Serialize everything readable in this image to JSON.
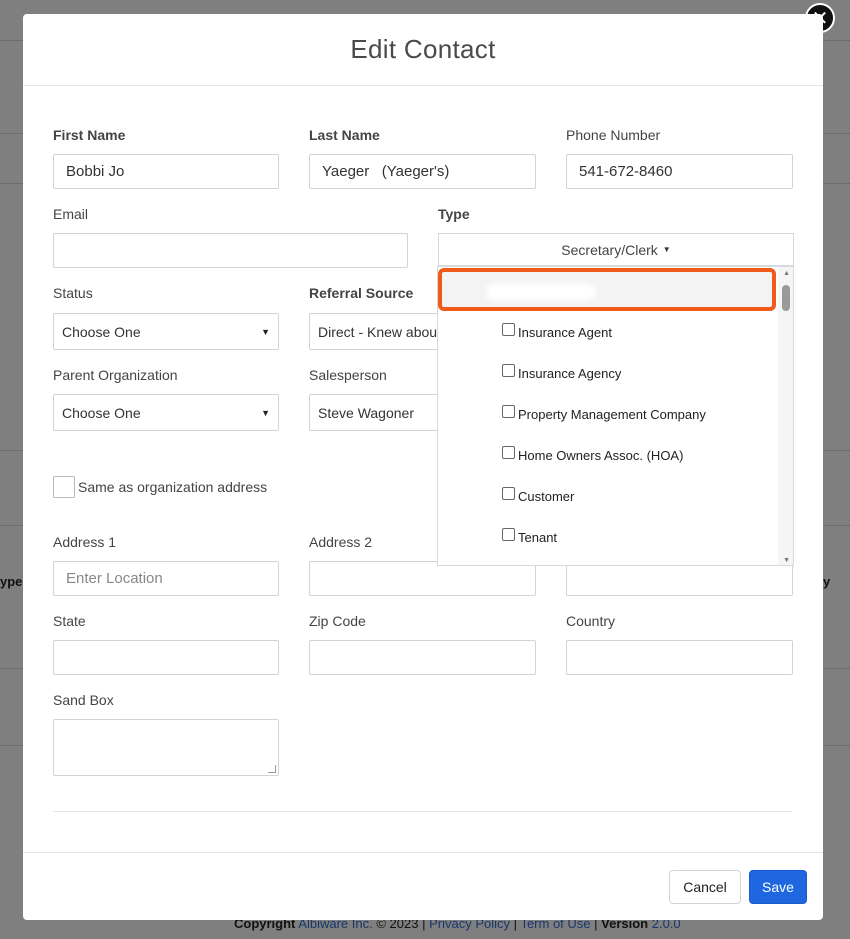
{
  "background": {
    "left_fragment": "ype",
    "right_fragment": "y",
    "footer": {
      "copyright_label": "Copyright",
      "company": "Albiware Inc.",
      "year": "© 2023",
      "sep": "|",
      "privacy": "Privacy Policy",
      "terms": "Term of Use",
      "version_label": "Version",
      "version": "2.0.0"
    }
  },
  "modal": {
    "title": "Edit Contact",
    "close_icon": "close-icon",
    "fields": {
      "first_name": {
        "label": "First Name",
        "value": "Bobbi Jo"
      },
      "last_name": {
        "label": "Last Name",
        "value": "Yaeger   (Yaeger's)"
      },
      "phone": {
        "label": "Phone Number",
        "value": "541-672-8460"
      },
      "email": {
        "label": "Email",
        "value": ""
      },
      "type": {
        "label": "Type",
        "value": "Secretary/Clerk"
      },
      "status": {
        "label": "Status",
        "value": "Choose One"
      },
      "referral_source": {
        "label": "Referral Source",
        "value": "Direct - Knew abou"
      },
      "parent_org": {
        "label": "Parent Organization",
        "value": "Choose One"
      },
      "salesperson": {
        "label": "Salesperson",
        "value": "Steve Wagoner"
      },
      "same_as_org": {
        "label": "Same as organization address"
      },
      "address1": {
        "label": "Address 1",
        "placeholder": "Enter Location"
      },
      "address2": {
        "label": "Address 2",
        "value": ""
      },
      "state": {
        "label": "State",
        "value": ""
      },
      "zip": {
        "label": "Zip Code",
        "value": ""
      },
      "country": {
        "label": "Country",
        "value": ""
      },
      "sandbox": {
        "label": "Sand Box",
        "value": ""
      }
    },
    "type_dropdown": {
      "options": [
        "Insurance Agent",
        "Insurance Agency",
        "Property Management Company",
        "Home Owners Assoc. (HOA)",
        "Customer",
        "Tenant"
      ]
    },
    "footer": {
      "cancel_label": "Cancel",
      "save_label": "Save"
    },
    "colors": {
      "primary": "#1f67e0",
      "highlight": "#f05a1a"
    }
  }
}
